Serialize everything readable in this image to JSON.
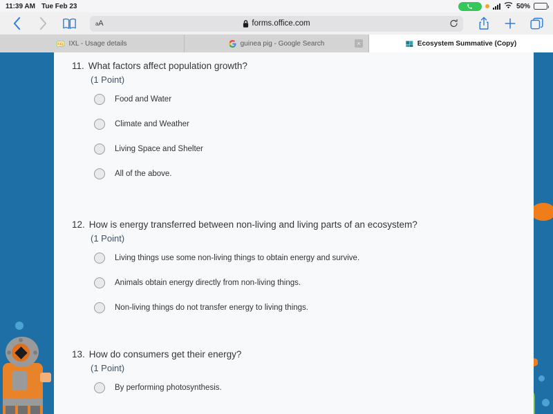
{
  "statusbar": {
    "time": "11:39 AM",
    "date": "Tue Feb 23",
    "call_icon": "phone-icon",
    "recording_dot": "orange-privacy-dot",
    "signal_icon": "cellular-bars-icon",
    "wifi_icon": "wifi-icon",
    "battery_percent": "50%",
    "battery_icon": "battery-icon"
  },
  "toolbar": {
    "back_icon": "chevron-left-icon",
    "forward_icon": "chevron-right-icon",
    "bookmarks_icon": "book-icon",
    "text_size_label": "aA",
    "lock_icon": "lock-icon",
    "url": "forms.office.com",
    "reload_icon": "reload-icon",
    "share_icon": "share-icon",
    "newtab_icon": "plus-icon",
    "tabs_icon": "tabs-overview-icon"
  },
  "tabs": [
    {
      "label": "IXL - Usage details",
      "favicon": "ixl-favicon",
      "active": false,
      "closable": false
    },
    {
      "label": "guinea pig - Google Search",
      "favicon": "google-favicon",
      "active": false,
      "closable": true,
      "close_label": "×"
    },
    {
      "label": "Ecosystem Summative (Copy)",
      "favicon": "microsoft-forms-favicon",
      "active": true,
      "closable": false
    }
  ],
  "form": {
    "questions": [
      {
        "number": "11.",
        "text": "What factors affect population growth?",
        "points": "(1 Point)",
        "options": [
          "Food and Water",
          "Climate and Weather",
          "Living Space and Shelter",
          "All of the above."
        ]
      },
      {
        "number": "12.",
        "text": "How is energy transferred between non-living and living parts of an ecosystem?",
        "points": "(1 Point)",
        "options": [
          "Living things use some non-living things to obtain energy and survive.",
          "Animals obtain energy directly from non-living things.",
          "Non-living things do not transfer energy to living things."
        ]
      },
      {
        "number": "13.",
        "text": "How do consumers get their energy?",
        "points": "(1 Point)",
        "options": [
          "By performing photosynthesis."
        ]
      }
    ]
  },
  "wallpaper": {
    "name": "underwater-diver-wallpaper",
    "background_color": "#1d6fa5",
    "accent_color": "#e8832a"
  }
}
